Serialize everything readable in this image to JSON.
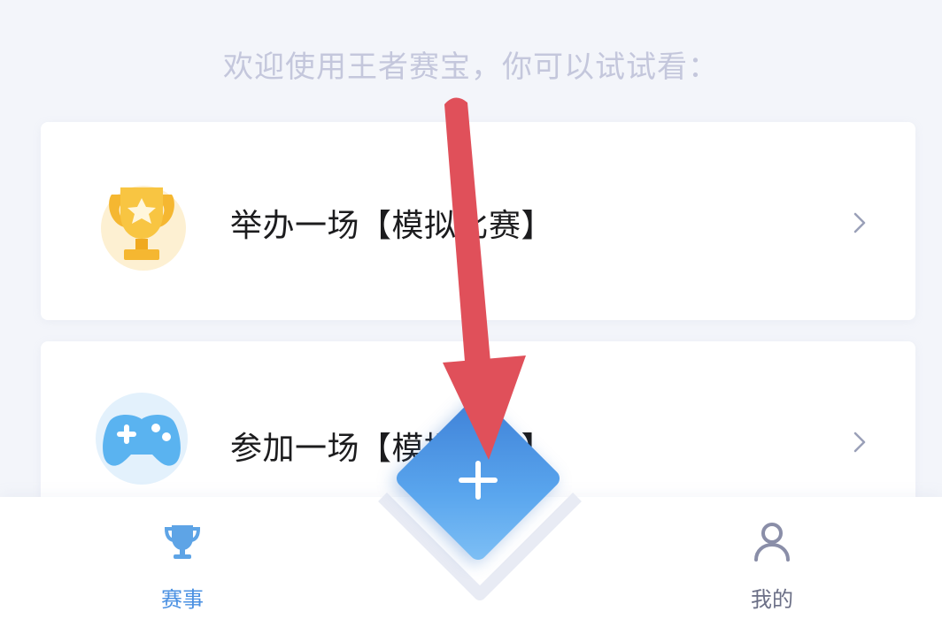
{
  "welcome_text": "欢迎使用王者赛宝，你可以试试看：",
  "cards": [
    {
      "label": "举办一场【模拟比赛】",
      "icon": "trophy-icon"
    },
    {
      "label": "参加一场【模拟比赛】",
      "icon": "gamepad-icon"
    }
  ],
  "fab": {
    "icon": "plus-icon"
  },
  "tabbar": {
    "events": {
      "label": "赛事",
      "icon": "trophy-outline-icon"
    },
    "mine": {
      "label": "我的",
      "icon": "person-icon"
    }
  },
  "colors": {
    "background": "#f3f5fa",
    "accent": "#4a90e2",
    "fab_gradient_start": "#3d7fd6",
    "fab_gradient_end": "#7fc0f5",
    "annotation_arrow": "#e0505a",
    "trophy_gold": "#f5b731"
  },
  "annotation": {
    "type": "arrow",
    "target": "fab"
  }
}
